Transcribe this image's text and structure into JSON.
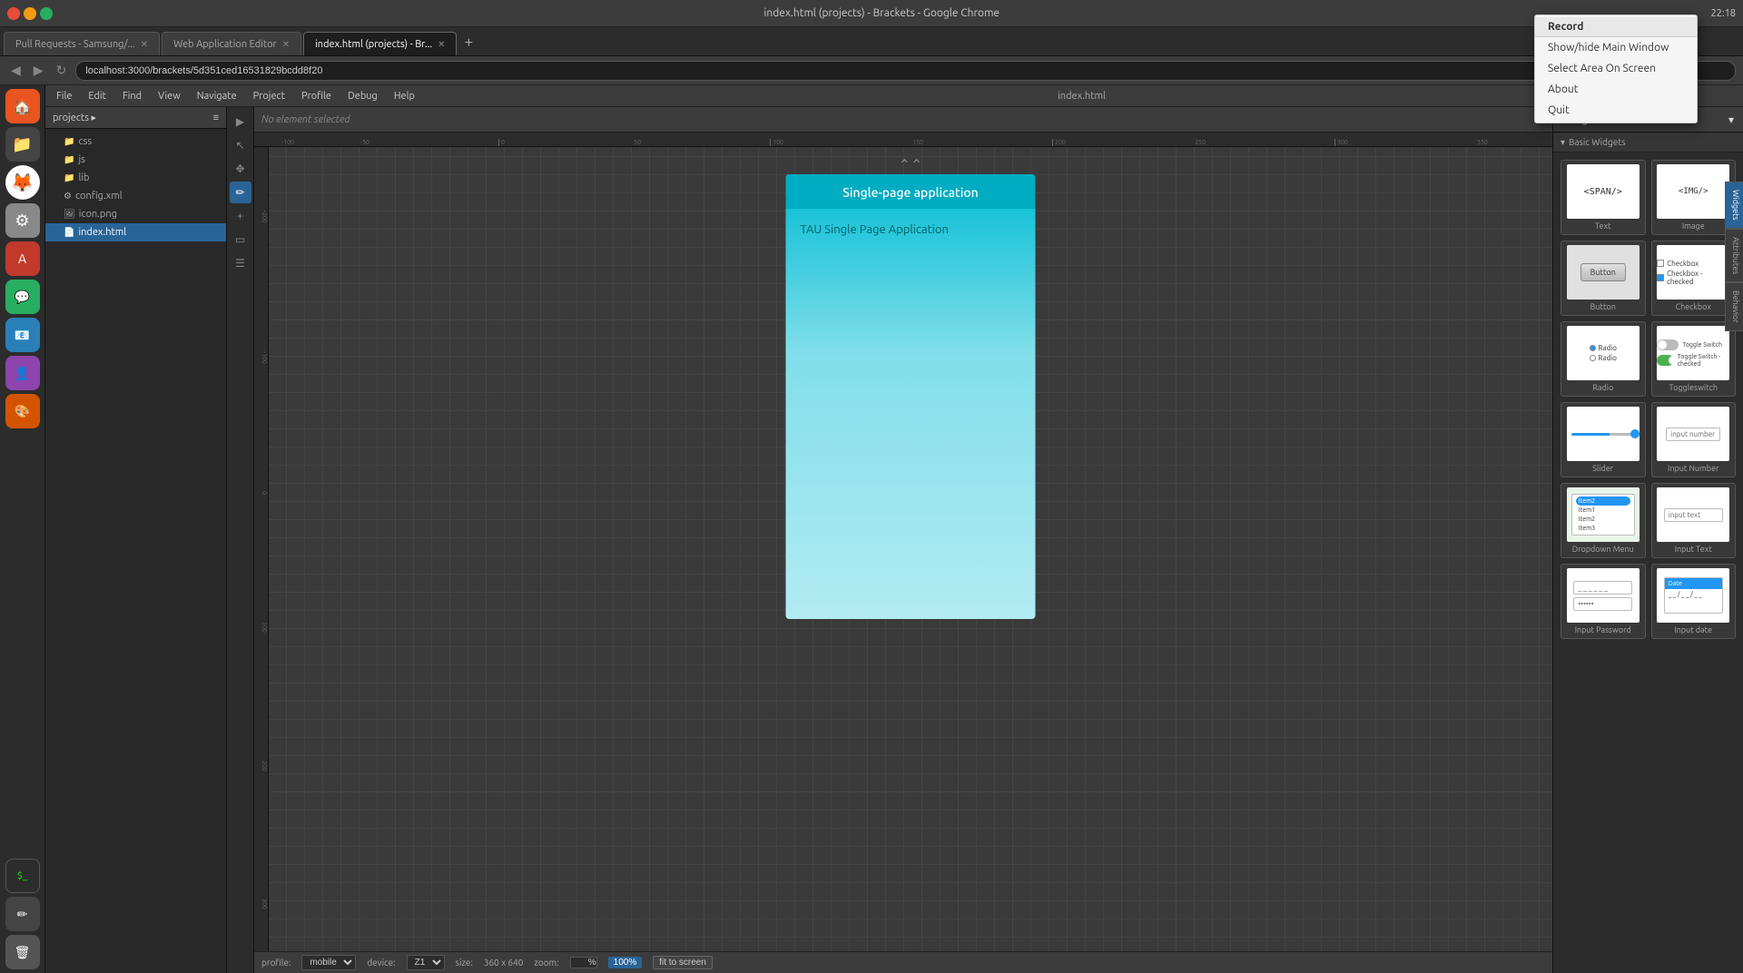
{
  "window": {
    "title": "index.html (projects) - Brackets - Google Chrome"
  },
  "tabs": [
    {
      "id": "tab1",
      "label": "Pull Requests - Samsung/...",
      "active": false
    },
    {
      "id": "tab2",
      "label": "Web Application Editor",
      "active": false
    },
    {
      "id": "tab3",
      "label": "index.html (projects) - Br...",
      "active": true
    }
  ],
  "address_bar": {
    "url": "localhost:3000/brackets/5d351ced16531829bcdd8f20"
  },
  "nav": {
    "back": "◀",
    "forward": "▶",
    "reload": "↻"
  },
  "brackets": {
    "title": "index.html",
    "menu": [
      "File",
      "Edit",
      "Find",
      "View",
      "Navigate",
      "Project",
      "Profile",
      "Debug",
      "Help"
    ],
    "selected_element": "No element selected"
  },
  "file_tree": {
    "project": "projects ▸",
    "items": [
      {
        "type": "folder",
        "name": "css",
        "icon": "📁",
        "level": "child"
      },
      {
        "type": "folder",
        "name": "js",
        "icon": "📁",
        "level": "child"
      },
      {
        "type": "folder",
        "name": "lib",
        "icon": "📁",
        "level": "child"
      },
      {
        "type": "file",
        "name": "config.xml",
        "icon": "⚙",
        "level": "child"
      },
      {
        "type": "file",
        "name": "icon.png",
        "icon": "🖼",
        "level": "child"
      },
      {
        "type": "file",
        "name": "index.html",
        "icon": "📄",
        "level": "child",
        "active": true
      }
    ]
  },
  "phone_preview": {
    "title": "Single-page application",
    "subtitle": "TAU Single Page Application"
  },
  "bottom_bar": {
    "profile_label": "profile:",
    "profile_value": "mobile",
    "device_label": "device:",
    "device_value": "Z1",
    "size_label": "size:",
    "size_value": "360 x 640",
    "zoom_label": "zoom:",
    "zoom_value": "100%",
    "fit_btn": "fit to screen"
  },
  "widgets_panel": {
    "title": "Widgets",
    "section": "Basic Widgets",
    "items": [
      {
        "id": "text",
        "label": "Text",
        "preview_type": "text"
      },
      {
        "id": "image",
        "label": "Image",
        "preview_type": "image"
      },
      {
        "id": "button",
        "label": "Button",
        "preview_type": "button"
      },
      {
        "id": "checkbox",
        "label": "Checkbox",
        "preview_type": "checkbox"
      },
      {
        "id": "radio",
        "label": "Radio",
        "preview_type": "radio"
      },
      {
        "id": "toggleswitch",
        "label": "Toggleswitch",
        "preview_type": "toggle"
      },
      {
        "id": "slider",
        "label": "Slider",
        "preview_type": "slider"
      },
      {
        "id": "input_number",
        "label": "Input Number",
        "preview_type": "input_number"
      },
      {
        "id": "dropdown_menu",
        "label": "Dropdown Menu",
        "preview_type": "dropdown"
      },
      {
        "id": "input_text",
        "label": "Input Text",
        "preview_type": "input_text"
      },
      {
        "id": "input_password",
        "label": "Input Password",
        "preview_type": "input_password"
      },
      {
        "id": "input_date",
        "label": "Input date",
        "preview_type": "input_date"
      }
    ]
  },
  "side_tabs": [
    "Widgets",
    "Attributes",
    "Behavior"
  ],
  "context_menu": {
    "title": "Record",
    "items": [
      {
        "label": "Show/hide Main Window"
      },
      {
        "label": "Select Area On Screen"
      },
      {
        "label": "About"
      },
      {
        "label": "Quit"
      }
    ]
  },
  "time": "22:18"
}
